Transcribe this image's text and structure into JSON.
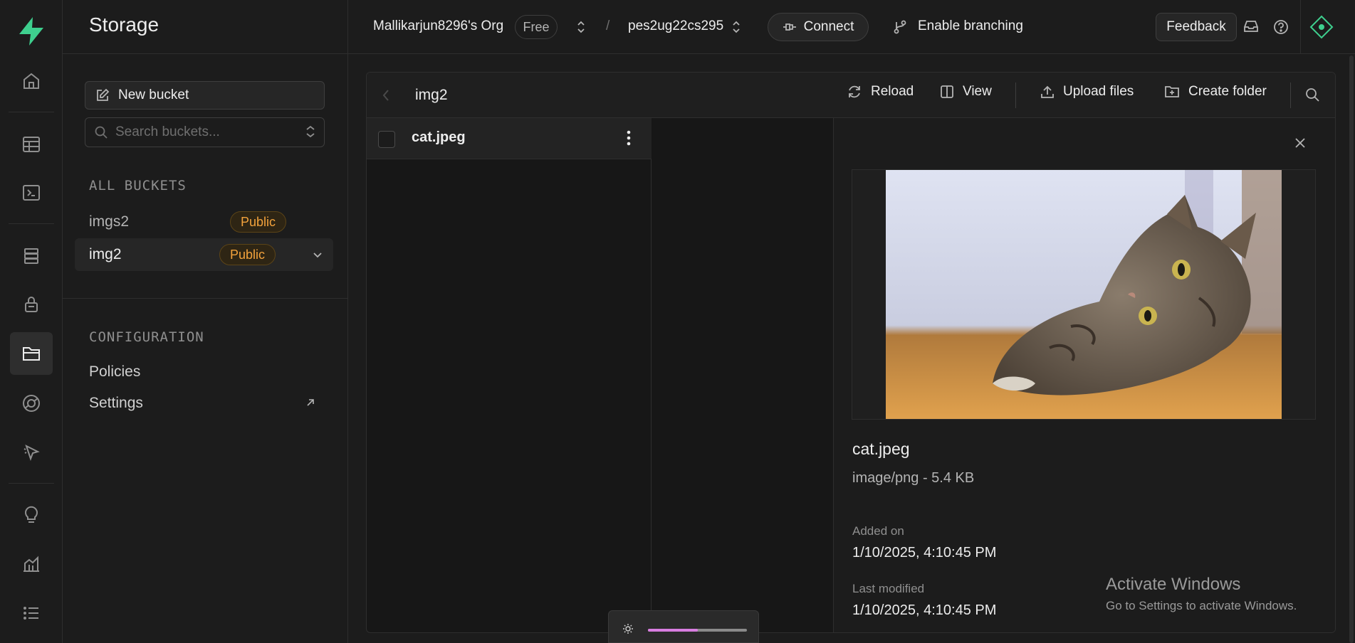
{
  "rail": {
    "icons": [
      "logo-icon",
      "home-icon",
      "table-editor-icon",
      "sql-editor-icon",
      "database-icon",
      "auth-icon",
      "storage-icon",
      "realtime-icon",
      "edge-functions-icon",
      "advisors-icon",
      "reports-icon",
      "logs-icon"
    ],
    "active": "storage-icon",
    "brand_color": "#3ecf8e"
  },
  "sidebar": {
    "title": "Storage",
    "new_bucket_label": "New bucket",
    "search_placeholder": "Search buckets...",
    "all_buckets_label": "ALL BUCKETS",
    "buckets": [
      {
        "name": "imgs2",
        "badge": "Public"
      },
      {
        "name": "img2",
        "badge": "Public"
      }
    ],
    "configuration_label": "CONFIGURATION",
    "links": [
      "Policies",
      "Settings"
    ]
  },
  "topbar": {
    "org_name": "Mallikarjun8296's Org",
    "plan": "Free",
    "separator": "/",
    "project": "pes2ug22cs295",
    "connect_label": "Connect",
    "branching_label": "Enable branching",
    "feedback_label": "Feedback"
  },
  "panel": {
    "bucket_name": "img2",
    "reload_label": "Reload",
    "view_label": "View",
    "upload_label": "Upload files",
    "create_folder_label": "Create folder",
    "files": [
      {
        "name": "cat.jpeg"
      }
    ]
  },
  "preview": {
    "file_name": "cat.jpeg",
    "meta": "image/png - 5.4 KB",
    "added_label": "Added on",
    "added_value": "1/10/2025, 4:10:45 PM",
    "modified_label": "Last modified",
    "modified_value": "1/10/2025, 4:10:45 PM"
  },
  "overlay": {
    "activate_title": "Activate Windows",
    "activate_sub": "Go to Settings to activate Windows.",
    "brightness_level": 0.5
  },
  "colors": {
    "accent_badge": "#f2a23c",
    "slider": "#d87de0"
  }
}
